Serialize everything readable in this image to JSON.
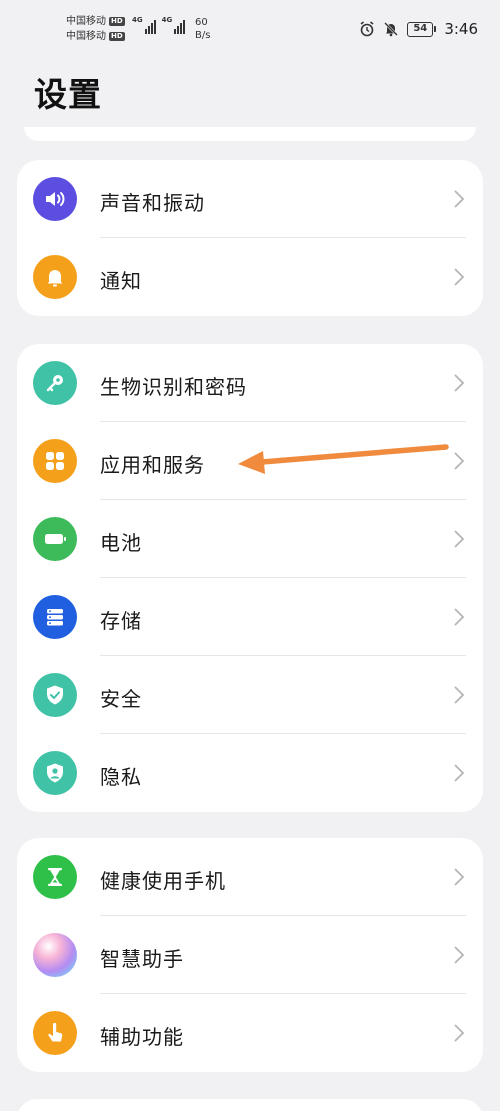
{
  "status_bar": {
    "carrier_1": "中国移动",
    "carrier_2": "中国移动",
    "hd_label": "HD",
    "network_gen": "4G",
    "net_speed_value": "60",
    "net_speed_unit": "B/s",
    "battery_level": "54",
    "time": "3:46",
    "icons": [
      "alarm-icon",
      "mute-icon",
      "battery-icon"
    ]
  },
  "header": {
    "title": "设置"
  },
  "groups": [
    {
      "items": [
        {
          "label": "声音和振动",
          "icon": "volume-icon",
          "color": "#5b4ee0"
        },
        {
          "label": "通知",
          "icon": "bell-icon",
          "color": "#f5a01a"
        }
      ]
    },
    {
      "items": [
        {
          "label": "生物识别和密码",
          "icon": "key-icon",
          "color": "#3fc2a6"
        },
        {
          "label": "应用和服务",
          "icon": "apps-grid-icon",
          "color": "#f5a01a"
        },
        {
          "label": "电池",
          "icon": "battery-icon",
          "color": "#3dbb5a"
        },
        {
          "label": "存储",
          "icon": "storage-icon",
          "color": "#1f5fe0"
        },
        {
          "label": "安全",
          "icon": "shield-check-icon",
          "color": "#3fc2a6"
        },
        {
          "label": "隐私",
          "icon": "privacy-icon",
          "color": "#3fc2a6"
        }
      ]
    },
    {
      "items": [
        {
          "label": "健康使用手机",
          "icon": "hourglass-icon",
          "color": "#2fc04a"
        },
        {
          "label": "智慧助手",
          "icon": "assistant-orb-icon",
          "color": "#e08ad8"
        },
        {
          "label": "辅助功能",
          "icon": "hand-pointer-icon",
          "color": "#f5a01a"
        }
      ]
    }
  ],
  "annotation": {
    "arrow_color": "#f08a3c",
    "points_to": "应用和服务"
  }
}
